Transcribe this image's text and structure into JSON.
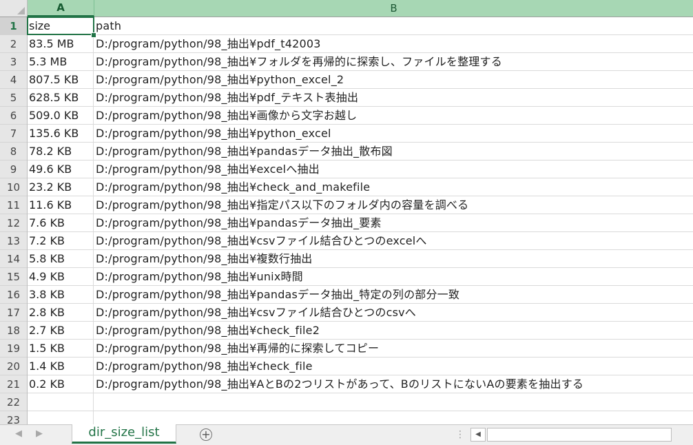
{
  "columns": {
    "a": "A",
    "b": "B"
  },
  "rows": [
    {
      "n": "1",
      "size": "size",
      "path": "path"
    },
    {
      "n": "2",
      "size": "83.5 MB",
      "path": "D:/program/python/98_抽出¥pdf_t42003"
    },
    {
      "n": "3",
      "size": "5.3 MB",
      "path": "D:/program/python/98_抽出¥フォルダを再帰的に探索し、ファイルを整理する"
    },
    {
      "n": "4",
      "size": "807.5 KB",
      "path": "D:/program/python/98_抽出¥python_excel_2"
    },
    {
      "n": "5",
      "size": "628.5 KB",
      "path": "D:/program/python/98_抽出¥pdf_テキスト表抽出"
    },
    {
      "n": "6",
      "size": "509.0 KB",
      "path": "D:/program/python/98_抽出¥画像から文字お越し"
    },
    {
      "n": "7",
      "size": "135.6 KB",
      "path": "D:/program/python/98_抽出¥python_excel"
    },
    {
      "n": "8",
      "size": "78.2 KB",
      "path": "D:/program/python/98_抽出¥pandasデータ抽出_散布図"
    },
    {
      "n": "9",
      "size": "49.6 KB",
      "path": "D:/program/python/98_抽出¥excelへ抽出"
    },
    {
      "n": "10",
      "size": "23.2 KB",
      "path": "D:/program/python/98_抽出¥check_and_makefile"
    },
    {
      "n": "11",
      "size": "11.6 KB",
      "path": "D:/program/python/98_抽出¥指定パス以下のフォルダ内の容量を調べる"
    },
    {
      "n": "12",
      "size": "7.6 KB",
      "path": "D:/program/python/98_抽出¥pandasデータ抽出_要素"
    },
    {
      "n": "13",
      "size": "7.2 KB",
      "path": "D:/program/python/98_抽出¥csvファイル結合ひとつのexcelへ"
    },
    {
      "n": "14",
      "size": "5.8 KB",
      "path": "D:/program/python/98_抽出¥複数行抽出"
    },
    {
      "n": "15",
      "size": "4.9 KB",
      "path": "D:/program/python/98_抽出¥unix時間"
    },
    {
      "n": "16",
      "size": "3.8 KB",
      "path": "D:/program/python/98_抽出¥pandasデータ抽出_特定の列の部分一致"
    },
    {
      "n": "17",
      "size": "2.8 KB",
      "path": "D:/program/python/98_抽出¥csvファイル結合ひとつのcsvへ"
    },
    {
      "n": "18",
      "size": "2.7 KB",
      "path": "D:/program/python/98_抽出¥check_file2"
    },
    {
      "n": "19",
      "size": "1.5 KB",
      "path": "D:/program/python/98_抽出¥再帰的に探索してコピー"
    },
    {
      "n": "20",
      "size": "1.4 KB",
      "path": "D:/program/python/98_抽出¥check_file"
    },
    {
      "n": "21",
      "size": "0.2 KB",
      "path": "D:/program/python/98_抽出¥AとBの2つリストがあって、BのリストにないAの要素を抽出する"
    },
    {
      "n": "22",
      "size": "",
      "path": ""
    },
    {
      "n": "23",
      "size": "",
      "path": ""
    }
  ],
  "sheet_tab": {
    "label": "dir_size_list"
  },
  "add_sheet_icon": "+",
  "selected_cell": "A1",
  "accent_color": "#217346"
}
